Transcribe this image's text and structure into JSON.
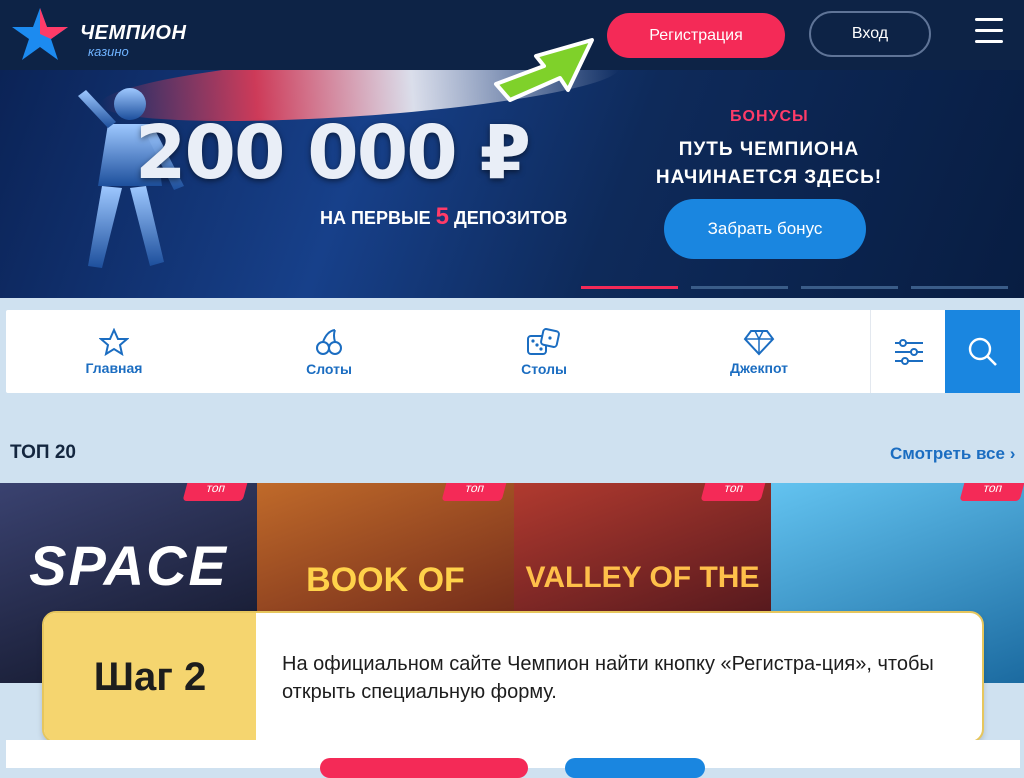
{
  "header": {
    "logo_title": "ЧЕМПИОН",
    "logo_sub": "казино",
    "register_label": "Регистрация",
    "login_label": "Вход"
  },
  "banner": {
    "amount": "200 000 ₽",
    "sub_prefix": "НА ПЕРВЫЕ",
    "sub_number": "5",
    "sub_suffix": "ДЕПОЗИТОВ",
    "tag": "БОНУСЫ",
    "title_line1": "ПУТЬ ЧЕМПИОНА",
    "title_line2": "НАЧИНАЕТСЯ ЗДЕСЬ!",
    "cta_label": "Забрать бонус",
    "slides": 4,
    "active_slide": 1
  },
  "nav": {
    "items": [
      {
        "label": "Главная",
        "icon": "star-icon"
      },
      {
        "label": "Слоты",
        "icon": "cherries-icon"
      },
      {
        "label": "Столы",
        "icon": "dice-icon"
      },
      {
        "label": "Джекпот",
        "icon": "diamond-icon"
      }
    ]
  },
  "top": {
    "title": "ТОП 20",
    "see_all": "Смотреть все",
    "badge": "топ",
    "games": [
      {
        "title": "SPACE",
        "bg": "#232845"
      },
      {
        "title": "BOOK OF",
        "bg": "#7a2a22"
      },
      {
        "title": "VALLEY OF THE",
        "bg": "#5c1d24"
      },
      {
        "title": "",
        "bg": "#2f8fc4"
      }
    ]
  },
  "step": {
    "label": "Шаг 2",
    "text": "На официальном сайте Чемпион найти кнопку «Регистра-ция», чтобы открыть специальную форму."
  },
  "colors": {
    "accent_red": "#f42a57",
    "accent_blue": "#1a86e0",
    "header_bg": "#0d2346",
    "step_yellow": "#f5d56f"
  }
}
